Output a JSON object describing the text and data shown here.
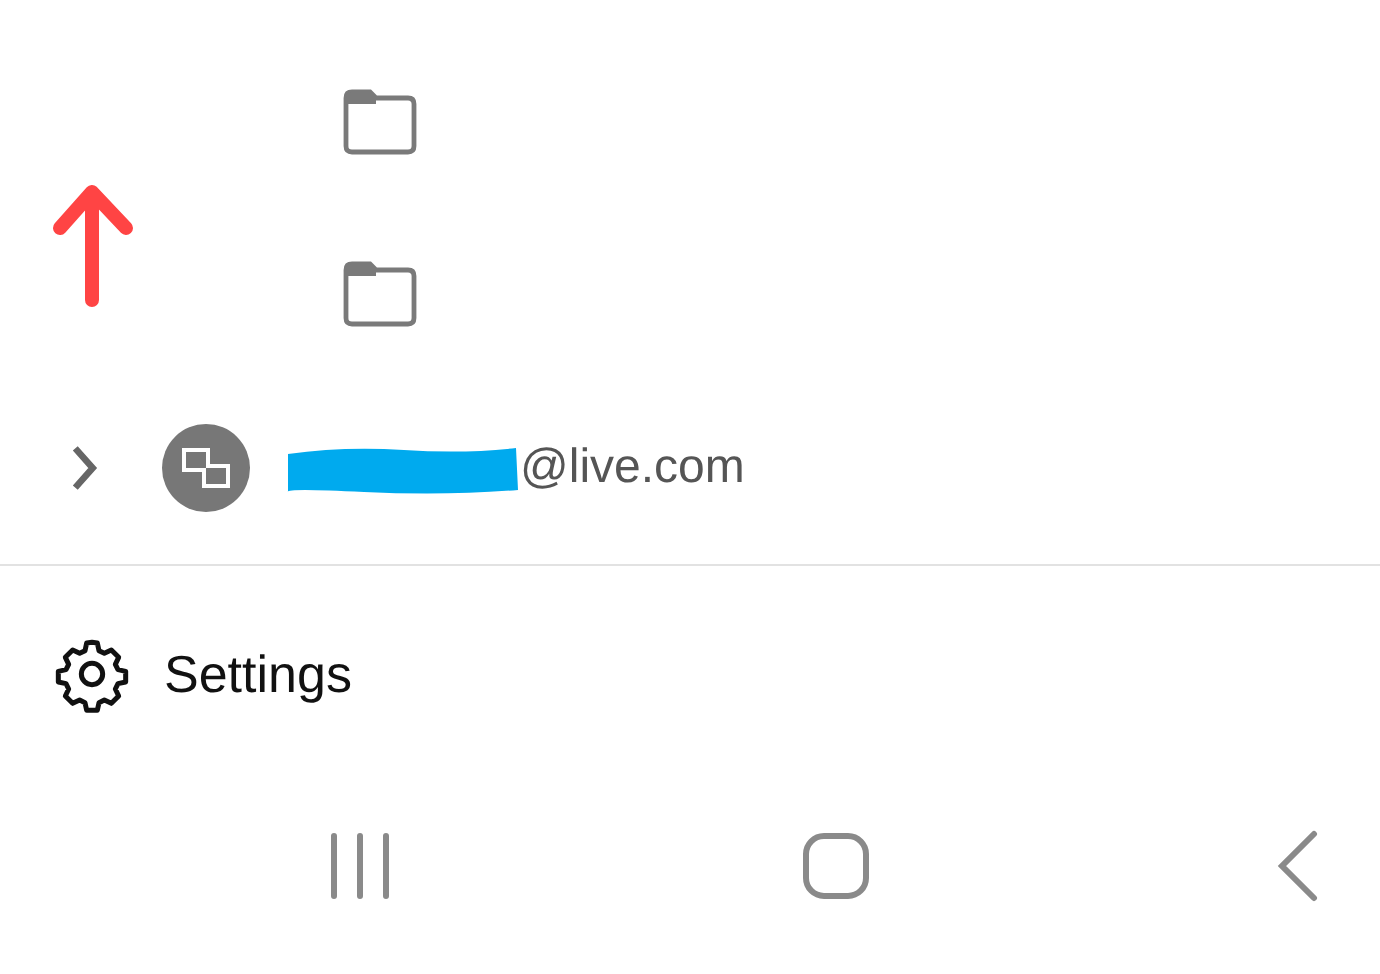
{
  "folders": [
    {
      "kind": "folder"
    },
    {
      "kind": "folder"
    }
  ],
  "account": {
    "email": "@live.com",
    "expanded": false
  },
  "settings": {
    "label": "Settings"
  }
}
